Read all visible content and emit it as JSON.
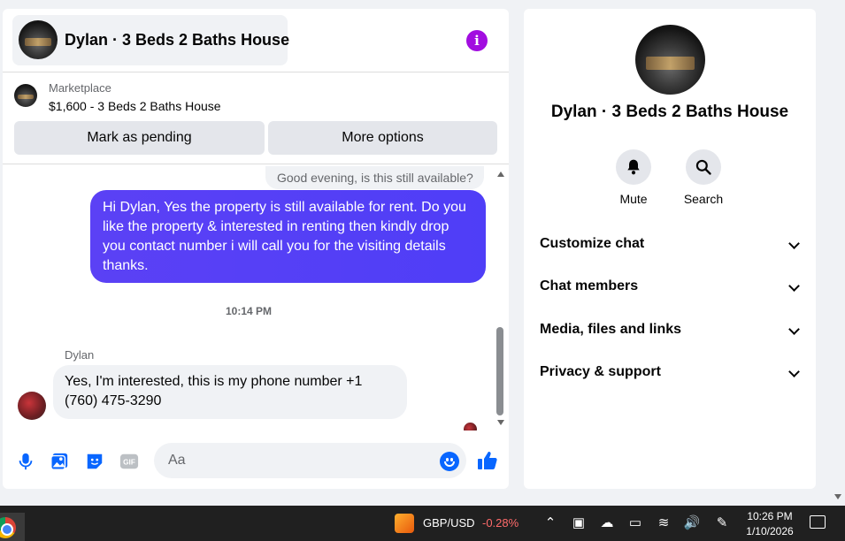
{
  "chat": {
    "title": "Dylan · 3 Beds 2 Baths House",
    "info_icon": "info-icon",
    "marketplace": {
      "label": "Marketplace",
      "listing": "$1,600 - 3 Beds 2 Baths House",
      "mark_pending": "Mark as pending",
      "more_options": "More options"
    },
    "messages": {
      "prev_preview": "Good evening, is this still available?",
      "outgoing": "Hi Dylan, Yes the property is still available for rent. Do you like the property & interested in renting then kindly drop you contact number i will call you for the visiting details thanks.",
      "timestamp": "10:14 PM",
      "sender": "Dylan",
      "incoming": "Yes, I'm interested, this is my phone number +1 (760) 475-3290"
    },
    "composer": {
      "placeholder": "Aa",
      "icons": [
        "microphone-icon",
        "photo-icon",
        "sticker-icon",
        "gif-icon",
        "emoji-icon",
        "thumbs-up-icon"
      ]
    }
  },
  "info": {
    "name": "Dylan · 3 Beds 2 Baths House",
    "actions": [
      {
        "label": "Mute",
        "icon": "bell-icon"
      },
      {
        "label": "Search",
        "icon": "search-icon"
      }
    ],
    "sections": [
      "Customize chat",
      "Chat members",
      "Media, files and links",
      "Privacy & support"
    ]
  },
  "taskbar": {
    "ticker_name": "GBP/USD",
    "ticker_value": "-0.28%",
    "time": "10:26 PM",
    "date": "1/10/2026"
  },
  "colors": {
    "accent_purple": "#a20de0",
    "bubble_out": "#5b41f5",
    "messenger_blue": "#0866ff",
    "ticker_negative": "#ff6b6b"
  }
}
